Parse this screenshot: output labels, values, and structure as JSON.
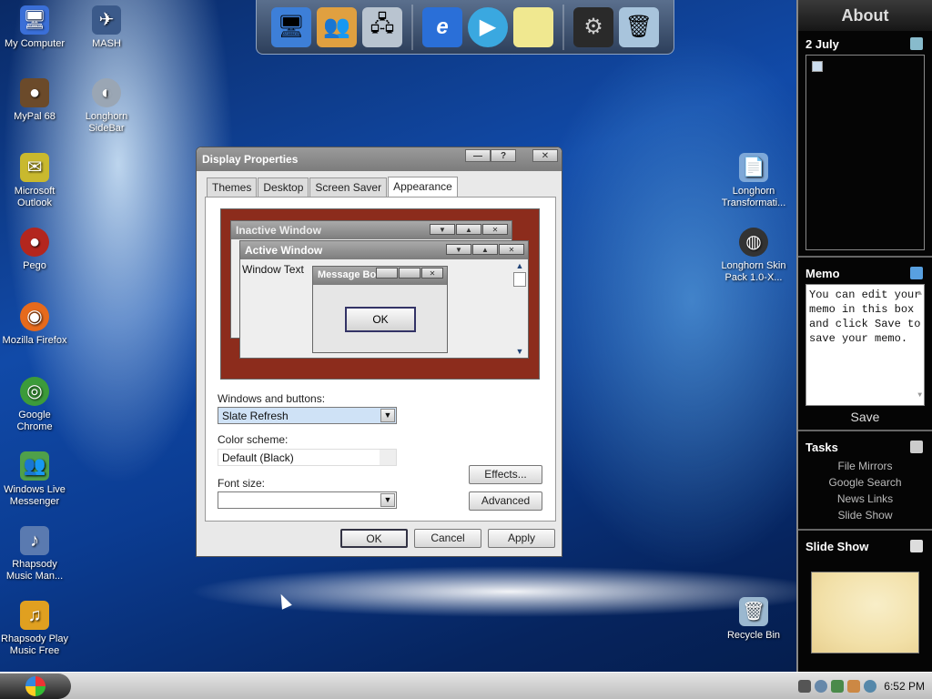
{
  "desktop": {
    "icons": [
      {
        "label": "My Computer",
        "icon": "computer-icon",
        "color": "#3a6fd8"
      },
      {
        "label": "MASH",
        "icon": "mash-icon",
        "color": "#3b5a8a"
      },
      {
        "label": "MyPal 68",
        "icon": "raccoon-icon",
        "color": "#6b4a2a"
      },
      {
        "label": "Longhorn SideBar",
        "icon": "sidebar-icon",
        "color": "#9aa6b4"
      },
      {
        "label": "Microsoft Outlook",
        "icon": "outlook-icon",
        "color": "#c9b92e"
      },
      {
        "label": "Pego",
        "icon": "pego-icon",
        "color": "#b3261e"
      },
      {
        "label": "Mozilla Firefox",
        "icon": "firefox-icon",
        "color": "#e66a1c"
      },
      {
        "label": "Google Chrome",
        "icon": "chrome-icon",
        "color": "#3c9b3a"
      },
      {
        "label": "Windows Live Messenger",
        "icon": "messenger-icon",
        "color": "#4fa04a"
      },
      {
        "label": "Rhapsody Music Man...",
        "icon": "rhapsody-icon",
        "color": "#5a7ab0"
      },
      {
        "label": "Rhapsody Play Music Free",
        "icon": "rhapsody-play-icon",
        "color": "#e0a020"
      },
      {
        "label": "Longhorn Transformati...",
        "icon": "document-icon",
        "color": "#7ea8d8"
      },
      {
        "label": "Longhorn Skin Pack 1.0-X...",
        "icon": "skinpack-icon",
        "color": "#333333"
      },
      {
        "label": "Recycle Bin",
        "icon": "recycle-bin-icon",
        "color": "#9bb8d0"
      }
    ]
  },
  "dock": {
    "items": [
      {
        "icon": "monitor-icon",
        "color": "#3d7fd8"
      },
      {
        "icon": "users-icon",
        "color": "#e0a040"
      },
      {
        "icon": "network-icon",
        "color": "#b9c4d0"
      },
      {
        "icon": "internet-explorer-icon",
        "color": "#2a6fd8"
      },
      {
        "icon": "media-player-icon",
        "color": "#3aa8e0"
      },
      {
        "icon": "notes-icon",
        "color": "#f0e890"
      },
      {
        "icon": "settings-window-icon",
        "color": "#2a2a2a"
      },
      {
        "icon": "trash-icon",
        "color": "#a8c4dc"
      }
    ]
  },
  "sidebar": {
    "about": "About",
    "date": "2 July",
    "memo_title": "Memo",
    "memo_text": "You can edit your memo in this box and click Save to save your memo.",
    "save_label": "Save",
    "tasks_title": "Tasks",
    "tasks": [
      "File Mirrors",
      "Google Search",
      "News Links",
      "Slide Show"
    ],
    "slideshow_title": "Slide Show"
  },
  "taskbar": {
    "clock": "6:52 PM"
  },
  "dialog": {
    "title": "Display Properties",
    "tabs": [
      "Themes",
      "Desktop",
      "Screen Saver",
      "Appearance"
    ],
    "active_tab": "Appearance",
    "preview": {
      "inactive_title": "Inactive Window",
      "active_title": "Active Window",
      "window_text": "Window Text",
      "message_title": "Message Box",
      "message_ok": "OK"
    },
    "windows_buttons_label": "Windows and buttons:",
    "windows_buttons_value": "Slate Refresh",
    "color_scheme_label": "Color scheme:",
    "color_scheme_value": "Default (Black)",
    "font_size_label": "Font size:",
    "font_size_value": "",
    "effects_label": "Effects...",
    "advanced_label": "Advanced",
    "ok_label": "OK",
    "cancel_label": "Cancel",
    "apply_label": "Apply"
  }
}
